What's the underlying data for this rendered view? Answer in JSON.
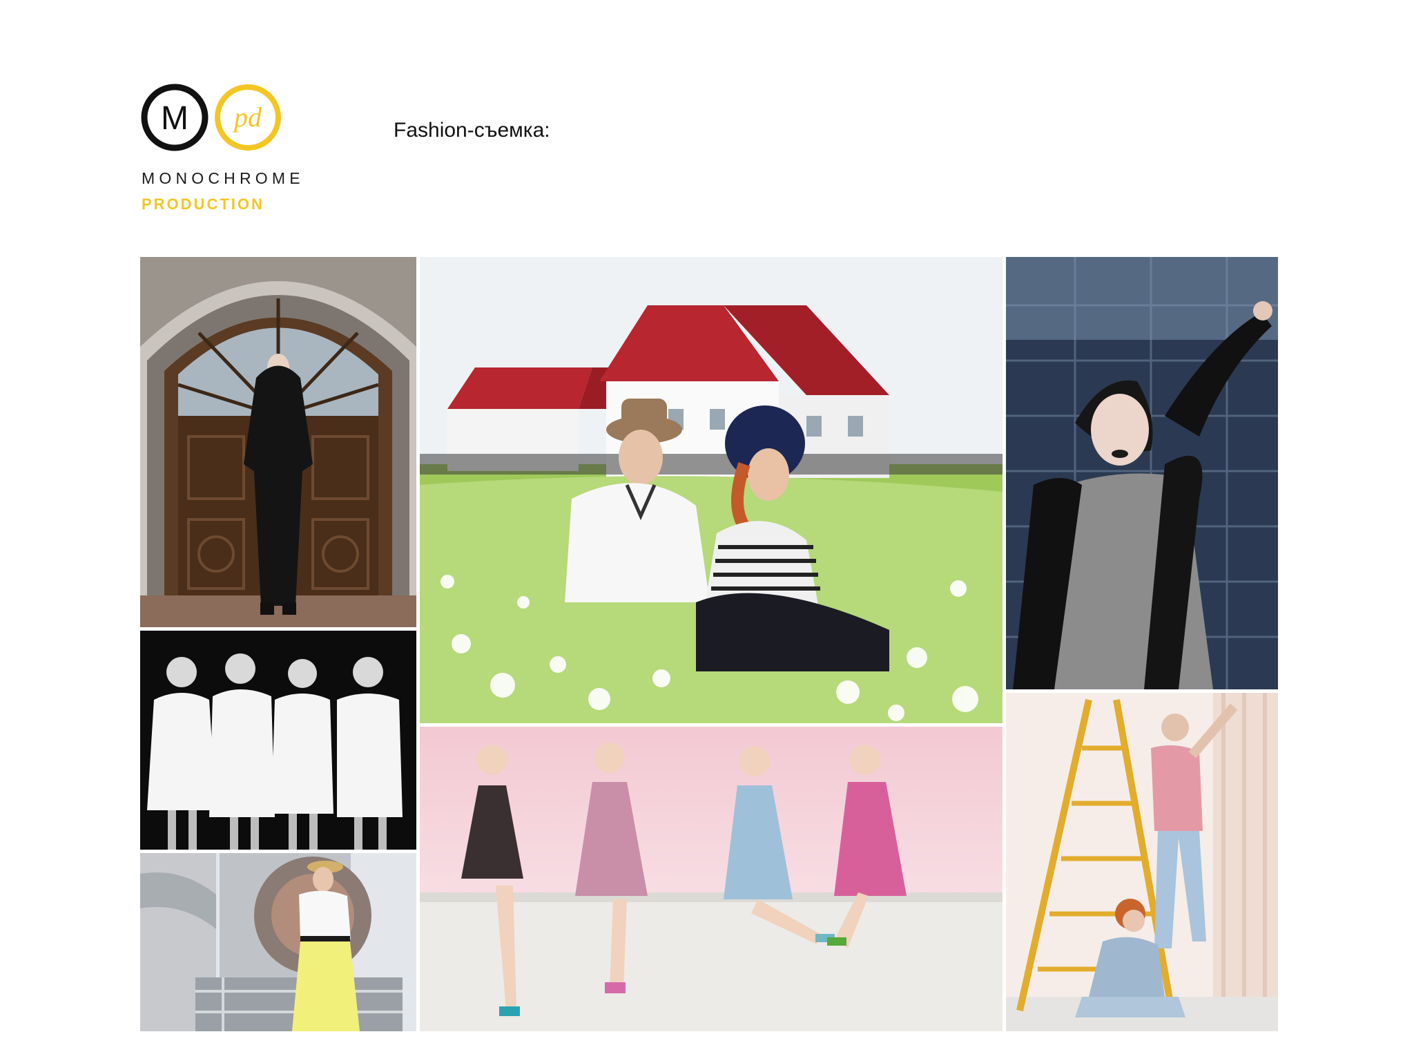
{
  "brand": {
    "name": "MONOCHROME",
    "tagline": "PRODUCTION",
    "mark_left": "M",
    "mark_right": "pd",
    "primary_color": "#111111",
    "accent_color": "#f3c623"
  },
  "section": {
    "title": "Fashion-съемка:"
  },
  "gallery": {
    "photos": [
      {
        "id": "arch-door-black-dress"
      },
      {
        "id": "couple-in-meadow"
      },
      {
        "id": "model-leather-jacket"
      },
      {
        "id": "four-models-white-shirts"
      },
      {
        "id": "four-models-floral-dresses"
      },
      {
        "id": "couple-with-ladder"
      },
      {
        "id": "model-yellow-skirt-industrial"
      }
    ]
  }
}
